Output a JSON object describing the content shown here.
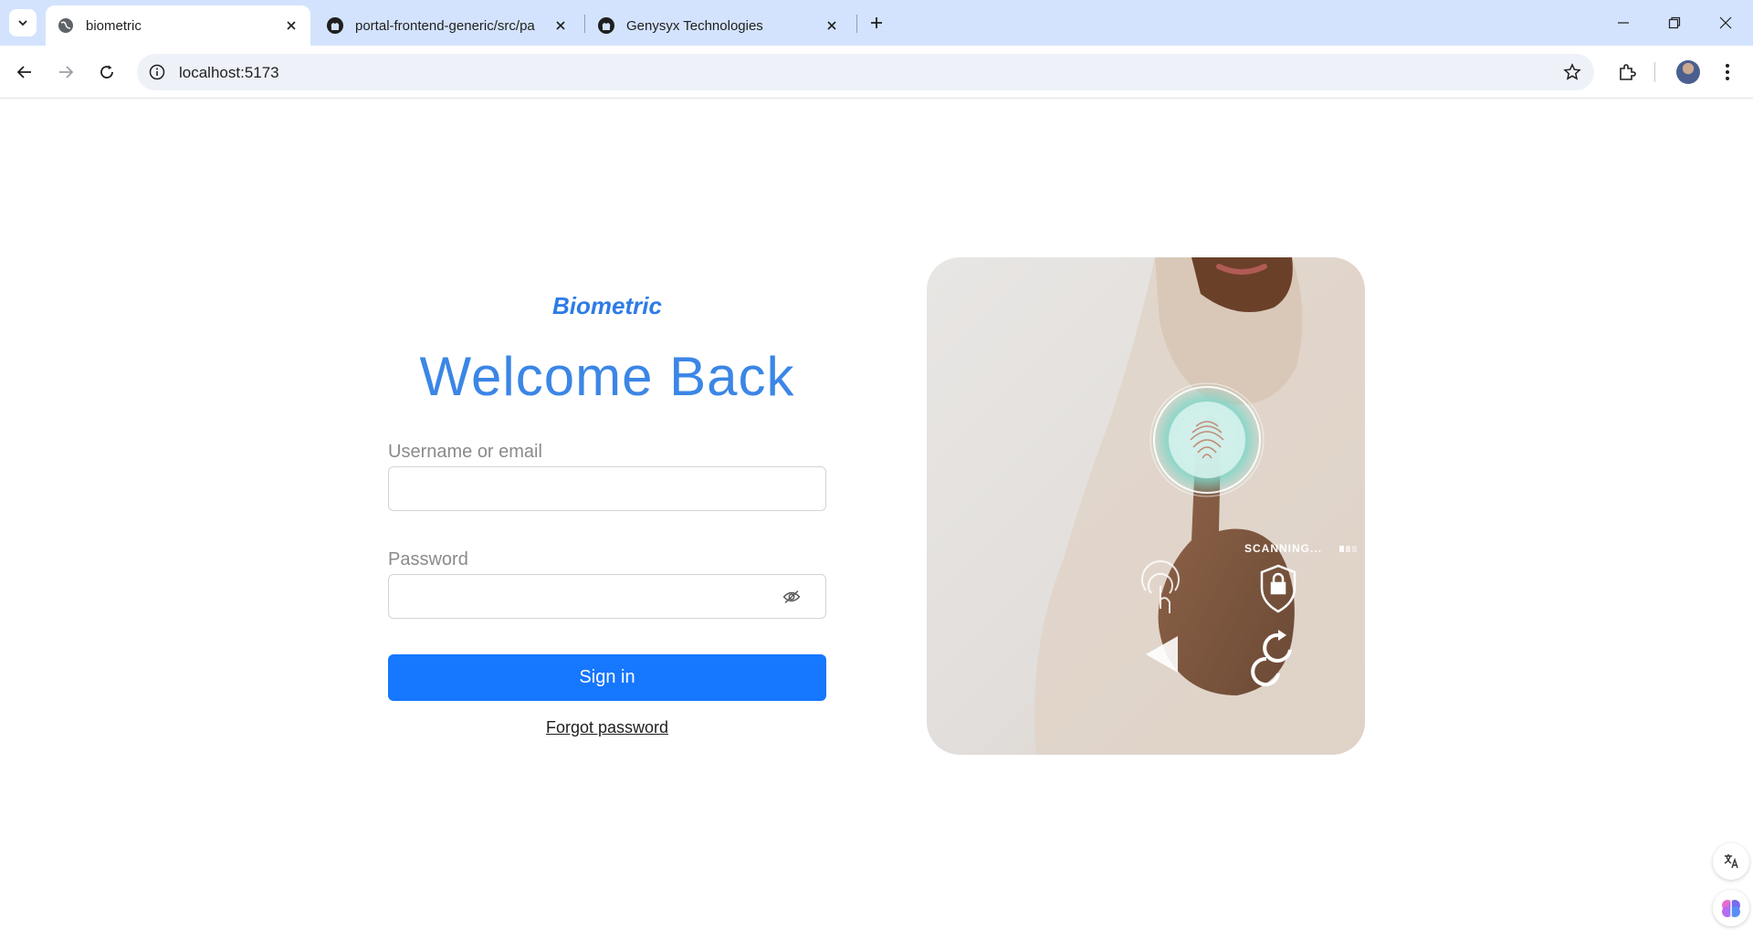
{
  "browser": {
    "tabs": [
      {
        "title": "biometric",
        "active": true,
        "icon": "globe-icon"
      },
      {
        "title": "portal-frontend-generic/src/pa",
        "active": false,
        "icon": "github-icon"
      },
      {
        "title": "Genysyx Technologies",
        "active": false,
        "icon": "github-icon"
      }
    ],
    "url": "localhost:5173"
  },
  "login": {
    "brand": "Biometric",
    "heading": "Welcome Back",
    "username_label": "Username or email",
    "username_value": "",
    "password_label": "Password",
    "password_value": "",
    "signin_label": "Sign in",
    "forgot_label": "Forgot password"
  },
  "hero": {
    "scanning_text": "SCANNING..."
  },
  "colors": {
    "accent": "#1677ff",
    "brand": "#2d7be6",
    "tabbar": "#d3e3fd"
  }
}
